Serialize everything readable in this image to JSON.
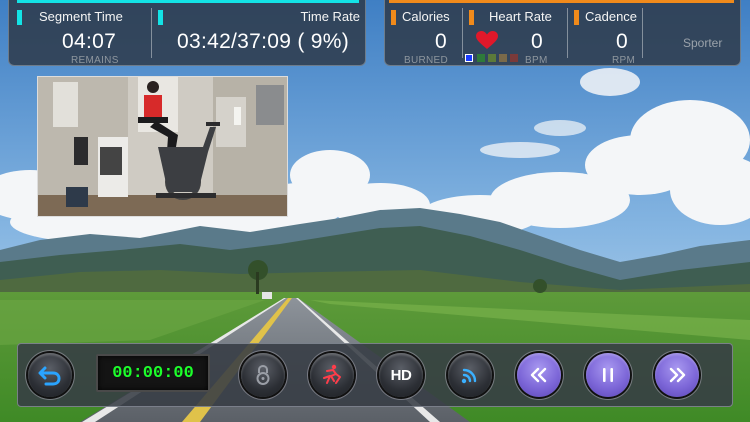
{
  "segment_time": {
    "label": "Segment Time",
    "value": "04:07",
    "sub": "REMAINS"
  },
  "time_rate": {
    "label": "Time Rate",
    "value": "03:42/37:09 ( 9%)"
  },
  "calories": {
    "label": "Calories",
    "value": "0",
    "sub": "BURNED"
  },
  "heart_rate": {
    "label": "Heart Rate",
    "value": "0",
    "sub": "BPM",
    "zones": [
      "#1a3cff",
      "#2e7a3a",
      "#5c7a3a",
      "#7a6a4a",
      "#7a3a3a"
    ]
  },
  "cadence": {
    "label": "Cadence",
    "value": "0",
    "sub": "RPM"
  },
  "brand": "Sporter",
  "controls": {
    "timer": "00:00:00"
  },
  "colors": {
    "accent_cyan": "#13e3e6",
    "accent_orange": "#f08a1b",
    "timer_green": "#1cff2a",
    "heart_red": "#e0182a",
    "button_purple": "#7d67d8"
  },
  "icons": {
    "back": "back-arrow-icon",
    "lock": "lock-icon",
    "rider": "cyclist-icon",
    "hd": "hd-icon",
    "signal": "wireless-signal-icon",
    "rewind": "rewind-icon",
    "pause": "pause-icon",
    "forward": "fast-forward-icon"
  }
}
